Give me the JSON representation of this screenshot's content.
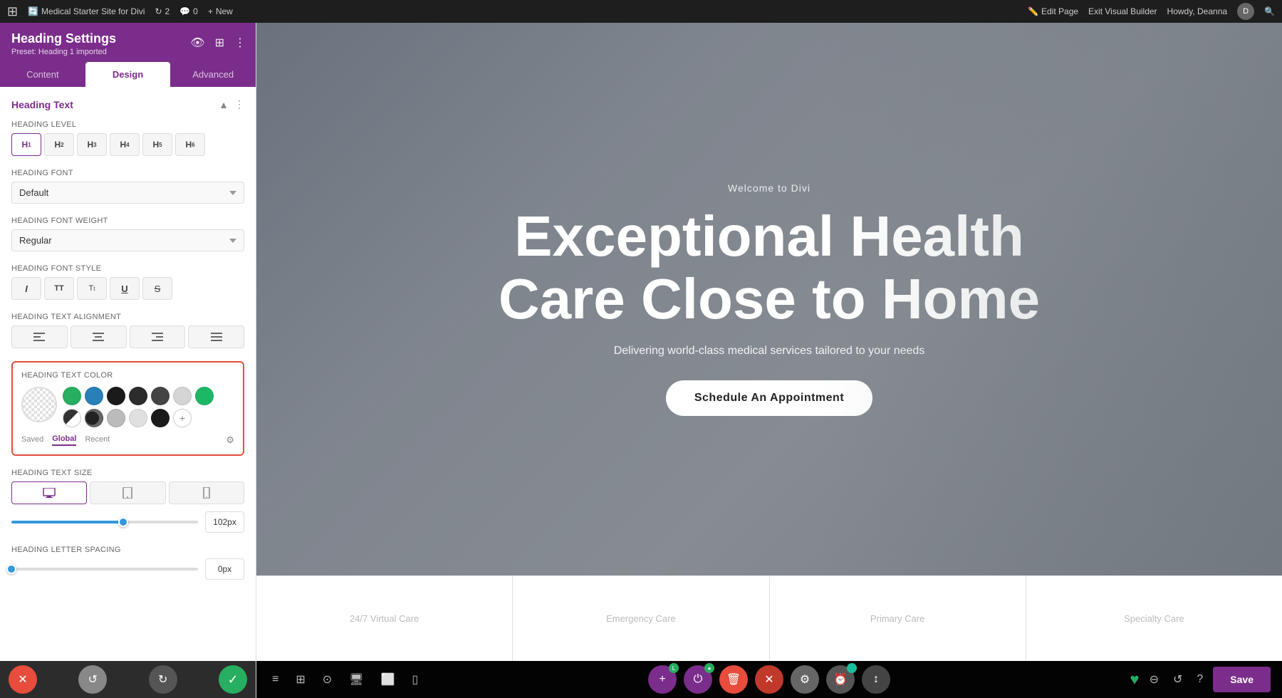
{
  "wp_bar": {
    "logo": "⊞",
    "site_name": "Medical Starter Site for Divi",
    "revisions": "2",
    "comments": "0",
    "new_label": "New",
    "edit_page": "Edit Page",
    "exit_vb": "Exit Visual Builder",
    "howdy": "Howdy, Deanna",
    "search_icon": "🔍"
  },
  "sidebar": {
    "title": "Heading Settings",
    "preset": "Preset: Heading 1 imported",
    "tabs": [
      "Content",
      "Design",
      "Advanced"
    ],
    "active_tab": "Design",
    "section_title": "Heading Text",
    "fields": {
      "heading_level_label": "Heading Level",
      "heading_levels": [
        "H1",
        "H2",
        "H3",
        "H4",
        "H5",
        "H6"
      ],
      "active_level": "H1",
      "heading_font_label": "Heading Font",
      "heading_font_value": "Default",
      "heading_font_weight_label": "Heading Font Weight",
      "heading_font_weight_value": "Regular",
      "heading_font_style_label": "Heading Font Style",
      "heading_text_alignment_label": "Heading Text Alignment",
      "heading_text_color_label": "Heading Text Color",
      "color_tabs": [
        "Saved",
        "Global",
        "Recent"
      ],
      "active_color_tab": "Global",
      "heading_text_size_label": "Heading Text Size",
      "size_value": "102px",
      "heading_letter_spacing_label": "Heading Letter Spacing",
      "letter_spacing_value": "0px"
    },
    "swatches": [
      "#27ae60",
      "#2980b9",
      "#1a1a1a",
      "#2c2c2c",
      "#3d3d3d",
      "#e0e0e0",
      "#1db866",
      "#333333",
      "#111111",
      "#888888",
      "#c0c0c0"
    ]
  },
  "hero": {
    "subtitle": "Welcome to Divi",
    "title_line1": "Exceptional Health",
    "title_line2": "Care Close to Home",
    "description": "Delivering world-class medical services tailored to your needs",
    "cta_button": "Schedule An Appointment"
  },
  "cards": [
    {
      "label": "24/7 Virtual Care"
    },
    {
      "label": "Emergency Care"
    },
    {
      "label": "Primary Care"
    },
    {
      "label": "Specialty Care"
    }
  ],
  "bottom_bar": {
    "discard_label": "✕",
    "undo_label": "↺",
    "redo_label": "↻",
    "confirm_label": "✓",
    "save_label": "Save"
  },
  "divi_toolbar": {
    "hamburger": "≡",
    "grid_icon": "⊞",
    "search_icon": "⊙",
    "desktop_icon": "🖥",
    "tablet_icon": "⬜",
    "mobile_icon": "▯",
    "add_icon": "+",
    "power_icon": "⏻",
    "trash_icon": "🗑",
    "close_icon": "✕",
    "settings_icon": "⚙",
    "clock_icon": "⏰",
    "sort_icon": "↕",
    "heart_icon": "♥",
    "zoom_icon": "⊖",
    "history_icon": "↺",
    "help_icon": "?",
    "save_label": "Save"
  }
}
